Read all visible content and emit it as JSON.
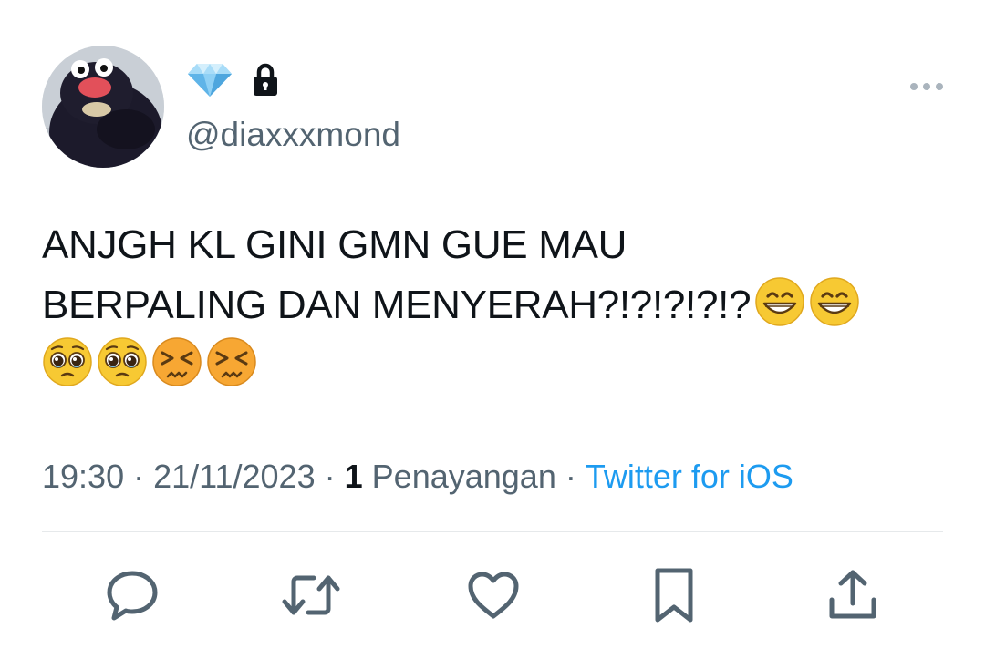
{
  "author": {
    "handle": "@diaxxxmond",
    "name_emoji": "diamond-icon",
    "protected_icon": "lock-icon"
  },
  "tweet": {
    "line1": "ANJGH KL GINI GMN GUE MAU",
    "line2": "BERPALING DAN MENYERAH?!?!?!?!?",
    "emojis_line2": [
      "grinning-face-emoji",
      "grinning-face-emoji"
    ],
    "emojis_line3": [
      "pleading-face-emoji",
      "pleading-face-emoji",
      "persevering-face-emoji",
      "persevering-face-emoji"
    ]
  },
  "meta": {
    "time": "19:30",
    "date": "21/11/2023",
    "views_count": "1",
    "views_label": "Penayangan",
    "source": "Twitter for iOS",
    "separator": "·"
  },
  "actions": [
    "reply-icon",
    "retweet-icon",
    "like-icon",
    "bookmark-icon",
    "share-icon"
  ],
  "colors": {
    "text": "#0f1419",
    "secondary": "#536471",
    "link": "#1d9bf0",
    "divider": "#e6e9eb"
  }
}
